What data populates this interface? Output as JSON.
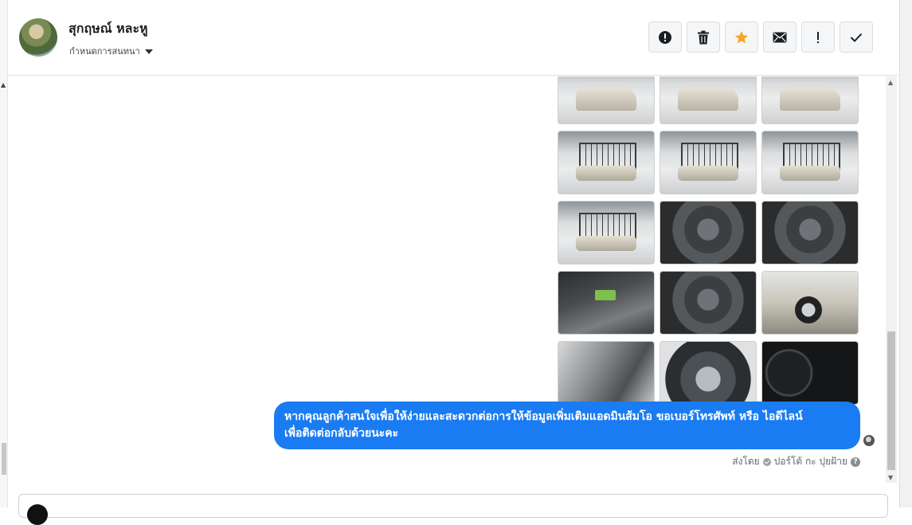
{
  "header": {
    "contact_name": "สุกฤษณ์ หละหู",
    "assign_label": "กำหนดการสนทนา",
    "actions": [
      {
        "name": "spam-button",
        "icon": "alert-circle-icon"
      },
      {
        "name": "delete-button",
        "icon": "trash-icon"
      },
      {
        "name": "star-button",
        "icon": "star-icon"
      },
      {
        "name": "mark-unread-button",
        "icon": "envelope-icon"
      },
      {
        "name": "follow-up-button",
        "icon": "exclamation-icon"
      },
      {
        "name": "mark-done-button",
        "icon": "checkmark-icon"
      }
    ]
  },
  "thread": {
    "photos": [
      "pickup-front-showroom",
      "pickup-front-showroom",
      "pickup-side-showroom",
      "pickup-rack-rear",
      "pickup-rack-rear",
      "pickup-rack-side",
      "pickup-rack-side",
      "interior-gearshift",
      "interior-steering",
      "dashboard-console",
      "interior-seats",
      "front-wheel",
      "door-panel",
      "engine-bay",
      "instrument-cluster"
    ],
    "message": {
      "line1": "หากคุณลูกค้าสนใจเพื่อให้ง่ายและสะดวกต่อการให้ข้อมูลเพิ่มเติมแอดมินส้มโอ ขอเบอร์โทรศัพท์ หรือ ไอดีไลน์",
      "line2": "เพื่อติดต่อกลับด้วยนะคะ"
    },
    "sent_by_label": "ส่งโดย",
    "sender_name": "ปอร์โต้ กะ ปุยฝ้าย",
    "help_glyph": "?"
  },
  "colors": {
    "bubble": "#1a7cf2",
    "star": "#f5a623"
  }
}
